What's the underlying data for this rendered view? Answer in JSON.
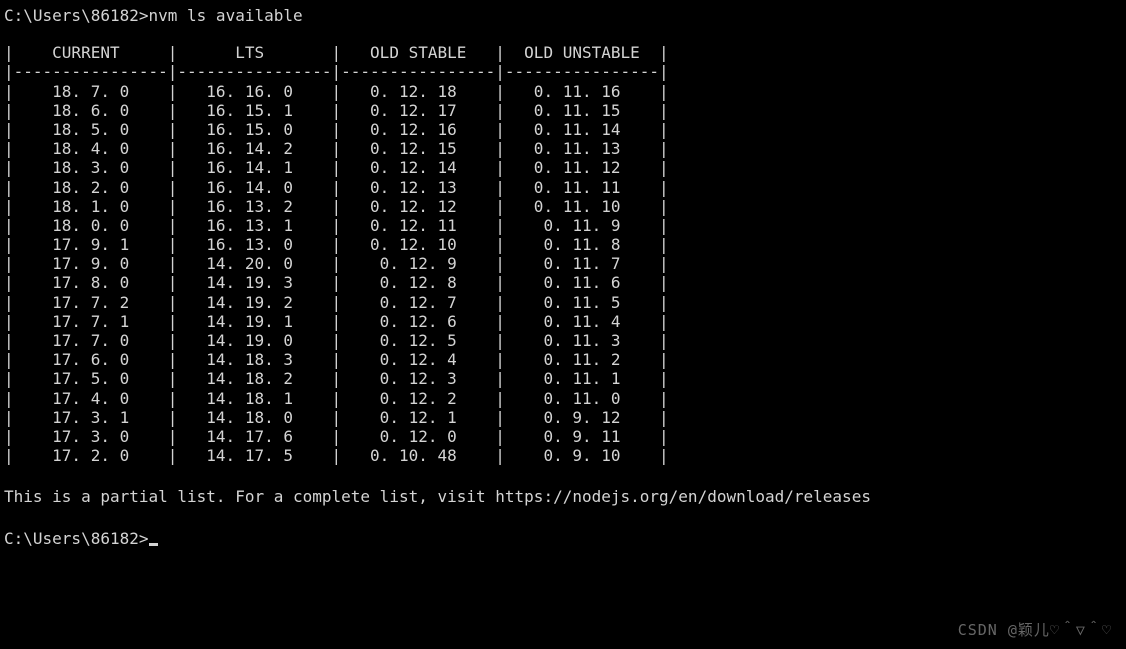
{
  "prompt1": {
    "path": "C:\\Users\\86182>",
    "command": "nvm ls available"
  },
  "table": {
    "headers": [
      "CURRENT",
      "LTS",
      "OLD STABLE",
      "OLD UNSTABLE"
    ],
    "rows": [
      [
        "18.7.0",
        "16.16.0",
        "0.12.18",
        "0.11.16"
      ],
      [
        "18.6.0",
        "16.15.1",
        "0.12.17",
        "0.11.15"
      ],
      [
        "18.5.0",
        "16.15.0",
        "0.12.16",
        "0.11.14"
      ],
      [
        "18.4.0",
        "16.14.2",
        "0.12.15",
        "0.11.13"
      ],
      [
        "18.3.0",
        "16.14.1",
        "0.12.14",
        "0.11.12"
      ],
      [
        "18.2.0",
        "16.14.0",
        "0.12.13",
        "0.11.11"
      ],
      [
        "18.1.0",
        "16.13.2",
        "0.12.12",
        "0.11.10"
      ],
      [
        "18.0.0",
        "16.13.1",
        "0.12.11",
        "0.11.9"
      ],
      [
        "17.9.1",
        "16.13.0",
        "0.12.10",
        "0.11.8"
      ],
      [
        "17.9.0",
        "14.20.0",
        "0.12.9",
        "0.11.7"
      ],
      [
        "17.8.0",
        "14.19.3",
        "0.12.8",
        "0.11.6"
      ],
      [
        "17.7.2",
        "14.19.2",
        "0.12.7",
        "0.11.5"
      ],
      [
        "17.7.1",
        "14.19.1",
        "0.12.6",
        "0.11.4"
      ],
      [
        "17.7.0",
        "14.19.0",
        "0.12.5",
        "0.11.3"
      ],
      [
        "17.6.0",
        "14.18.3",
        "0.12.4",
        "0.11.2"
      ],
      [
        "17.5.0",
        "14.18.2",
        "0.12.3",
        "0.11.1"
      ],
      [
        "17.4.0",
        "14.18.1",
        "0.12.2",
        "0.11.0"
      ],
      [
        "17.3.1",
        "14.18.0",
        "0.12.1",
        "0.9.12"
      ],
      [
        "17.3.0",
        "14.17.6",
        "0.12.0",
        "0.9.11"
      ],
      [
        "17.2.0",
        "14.17.5",
        "0.10.48",
        "0.9.10"
      ]
    ]
  },
  "footer": "This is a partial list. For a complete list, visit https://nodejs.org/en/download/releases",
  "prompt2": {
    "path": "C:\\Users\\86182>"
  },
  "watermark": "CSDN @颖儿♡＾▽＾♡"
}
